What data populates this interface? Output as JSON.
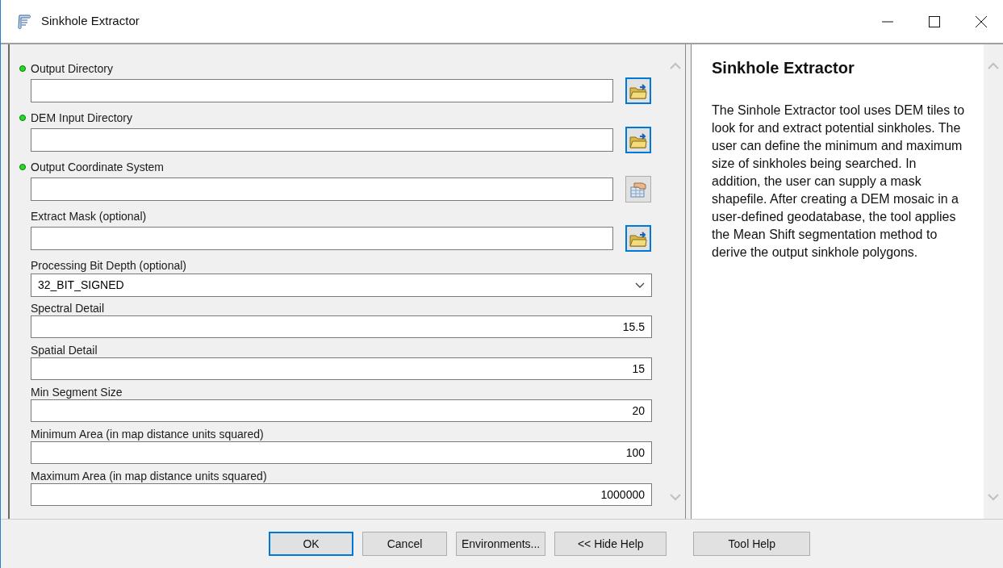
{
  "window": {
    "title": "Sinkhole Extractor"
  },
  "params": [
    {
      "label": "Output Directory",
      "required": true,
      "kind": "folder"
    },
    {
      "label": "DEM Input Directory",
      "required": true,
      "kind": "folder"
    },
    {
      "label": "Output Coordinate System",
      "required": true,
      "kind": "coordinate"
    },
    {
      "label": "Extract Mask (optional)",
      "required": false,
      "kind": "folder"
    },
    {
      "label": "Processing Bit Depth (optional)",
      "required": false,
      "kind": "dropdown",
      "value": "32_BIT_SIGNED"
    },
    {
      "label": "Spectral Detail",
      "required": false,
      "kind": "number",
      "value": "15.5"
    },
    {
      "label": "Spatial Detail",
      "required": false,
      "kind": "number",
      "value": "15"
    },
    {
      "label": "Min Segment Size",
      "required": false,
      "kind": "number",
      "value": "20"
    },
    {
      "label": "Minimum Area (in map distance units squared)",
      "required": false,
      "kind": "number",
      "value": "100"
    },
    {
      "label": "Maximum Area (in map distance units squared)",
      "required": false,
      "kind": "number",
      "value": "1000000"
    }
  ],
  "help": {
    "title": "Sinkhole Extractor",
    "body": "The Sinhole Extractor tool uses DEM tiles to look for and extract potential sinkholes. The user can define the minimum and maximum size of sinkholes being searched. In addition, the user can supply a mask shapefile. After creating a DEM mosaic in a user-defined geodatabase, the tool applies the Mean Shift segmentation method to derive the output sinkhole polygons."
  },
  "buttons": [
    {
      "label": "OK",
      "focused": true
    },
    {
      "label": "Cancel",
      "focused": false
    },
    {
      "label": "Environments...",
      "focused": false
    },
    {
      "label": "<< Hide Help",
      "focused": false
    },
    {
      "label": "Tool Help",
      "focused": false
    }
  ]
}
